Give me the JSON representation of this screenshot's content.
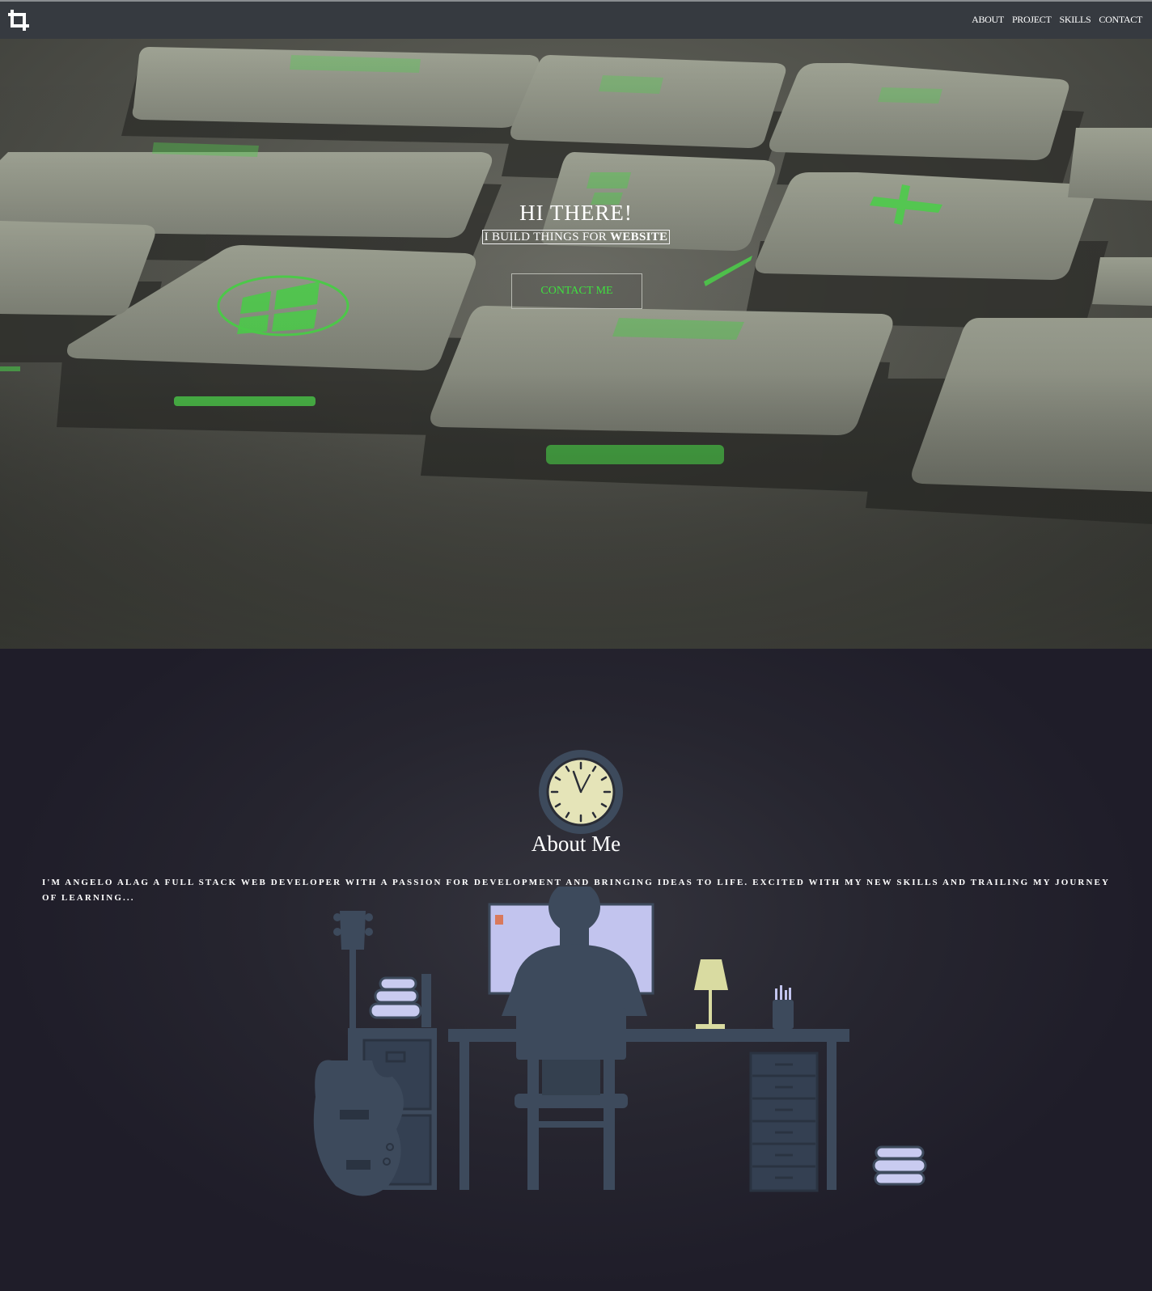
{
  "nav": {
    "logo_icon": "crop-icon",
    "links": [
      "ABOUT",
      "PROJECT",
      "SKILLS",
      "CONTACT"
    ]
  },
  "hero": {
    "title": "HI THERE!",
    "subtitle_prefix": "I BUILD THINGS FOR ",
    "subtitle_bold": "WEBSITE",
    "button_label": "CONTACT ME",
    "accent_color": "#3fe040"
  },
  "about": {
    "icon": "clock-icon",
    "title": "About Me",
    "text": "I'M ANGELO ALAG A FULL STACK WEB DEVELOPER WITH A PASSION FOR DEVELOPMENT AND BRINGING IDEAS TO LIFE. EXCITED WITH MY NEW SKILLS AND TRAILING MY JOURNEY OF LEARNING...",
    "illustration": "desk-workspace-illustration"
  },
  "colors": {
    "navbar": "#363a40",
    "about_bg": "#1f1d29",
    "silhouette": "#3d4a5c"
  }
}
